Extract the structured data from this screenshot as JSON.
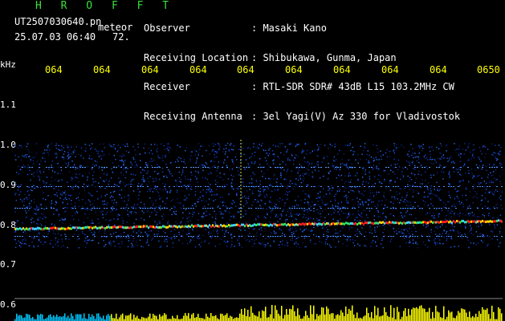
{
  "header": {
    "title": "H R O F F T",
    "filename": "UT2507030640.pn",
    "meteor_label": "meteor",
    "datetime": "25.07.03 06:40",
    "number": "72.",
    "meta": [
      {
        "label": "Observer",
        "value": ": Masaki Kano"
      },
      {
        "label": "Receiving Location",
        "value": ": Shibukawa, Gunma, Japan"
      },
      {
        "label": "Receiver",
        "value": ": RTL-SDR SDR# 43dB L15 103.2MHz CW"
      },
      {
        "label": "Receiving Antenna",
        "value": ": 3el Yagi(V) Az 330 for Vladivostok"
      }
    ]
  },
  "axis": {
    "unit": "kHz",
    "time_ticks": [
      "064",
      "064",
      "064",
      "064",
      "064",
      "064",
      "064",
      "064",
      "064",
      "0650"
    ],
    "freq_labels": [
      "1.1",
      "1.0",
      "0.9",
      "0.8",
      "0.7",
      "0.6"
    ]
  },
  "colors": {
    "background": "#000000",
    "tick_text": "#ffff00",
    "title_text": "#38e038",
    "noise_blue": "#0a2a9a",
    "signal_red": "#ff2020",
    "level_bar": "#ffff00",
    "level_bar_base": "#00c8ff"
  }
}
